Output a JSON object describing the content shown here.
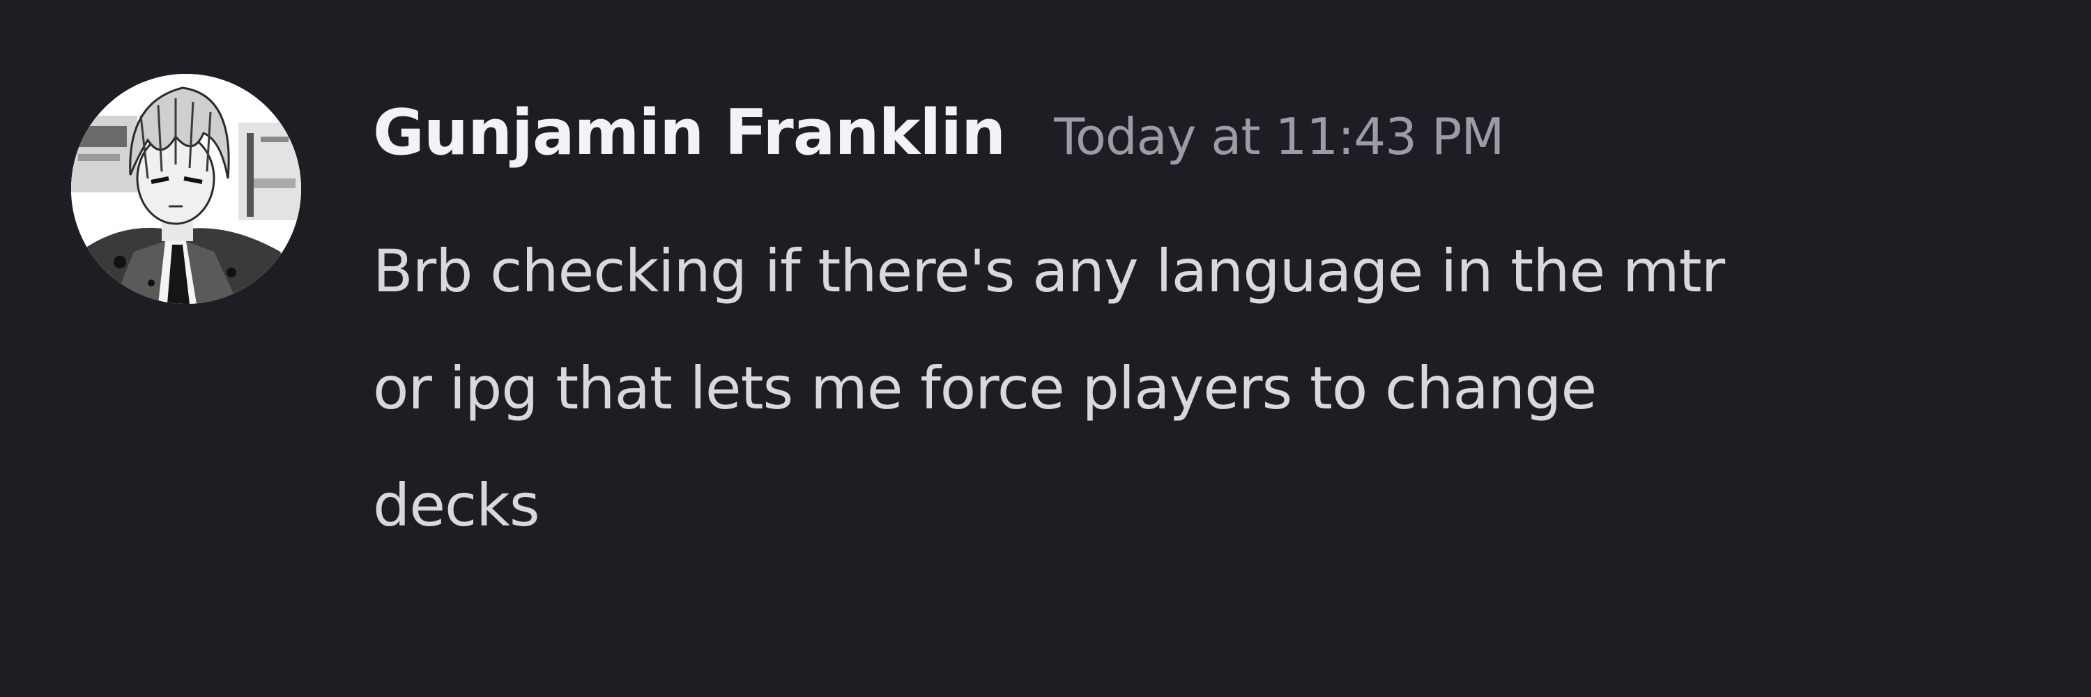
{
  "message": {
    "author": "Gunjamin Franklin",
    "timestamp": "Today at 11:43 PM",
    "lines": [
      "Brb checking if there's any language in the mtr",
      "or ipg that lets me force players to change",
      "decks"
    ]
  },
  "colors": {
    "background": "#1d1d23",
    "author": "#f2f3f5",
    "timestamp": "#9a9ca6",
    "text": "#d8d9de"
  }
}
